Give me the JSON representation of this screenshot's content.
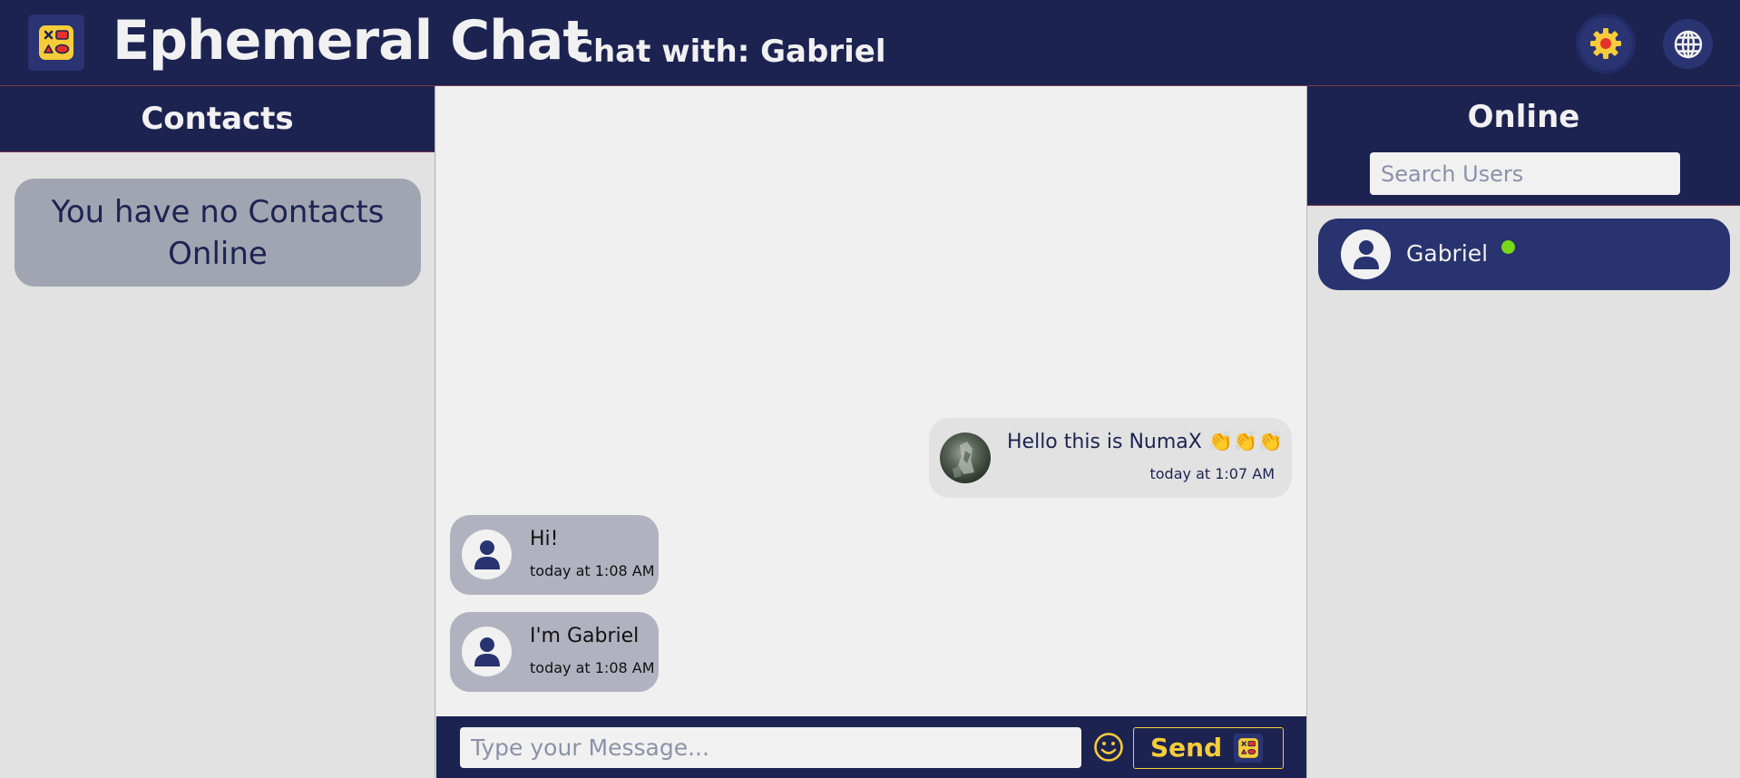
{
  "header": {
    "app_title": "Ephemeral Chat",
    "chat_with": "Chat with: Gabriel",
    "settings_icon": "gear-icon",
    "language_icon": "globe-icon"
  },
  "contacts": {
    "title": "Contacts",
    "empty_message": "You have no Contacts Online"
  },
  "messages": [
    {
      "text": "Hello this is NumaX 👏👏👏",
      "time": "today at 1:07 AM",
      "sender": "me"
    },
    {
      "text": "Hi!",
      "time": "today at 1:08 AM",
      "sender": "Gabriel"
    },
    {
      "text": "I'm Gabriel",
      "time": "today at 1:08 AM",
      "sender": "Gabriel"
    }
  ],
  "composer": {
    "placeholder": "Type your Message...",
    "send_label": "Send"
  },
  "online": {
    "title": "Online",
    "search_placeholder": "Search Users",
    "users": [
      {
        "name": "Gabriel",
        "status": "online"
      }
    ]
  },
  "colors": {
    "navy": "#1d2351",
    "accent_yellow": "#f6cc3a",
    "online_green": "#79d81a",
    "bubble_gray": "#b0b3bf"
  }
}
